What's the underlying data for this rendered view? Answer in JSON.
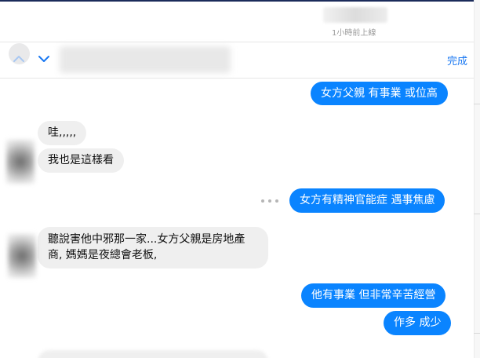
{
  "header": {
    "status": "1小時前上線"
  },
  "search": {
    "done_label": "完成"
  },
  "messages": [
    {
      "direction": "outgoing",
      "text": "女方父親 有事業 或位高"
    },
    {
      "direction": "incoming",
      "text": "哇,,,,,"
    },
    {
      "direction": "incoming",
      "text": "我也是這樣看"
    },
    {
      "direction": "outgoing",
      "text": "女方有精神官能症 遇事焦慮"
    },
    {
      "direction": "incoming",
      "lines": [
        "聽說害他中邪那一家...女方父親是房地產",
        "商, 媽媽是夜總會老板,"
      ]
    },
    {
      "direction": "outgoing",
      "text": "他有事業 但非常辛苦經營"
    },
    {
      "direction": "outgoing",
      "text": "作多 成少"
    }
  ],
  "colors": {
    "outgoing_bubble": "#0a84ff",
    "incoming_bubble": "#efefef",
    "accent": "#1877f2"
  },
  "icons": [
    "chevron-up-icon",
    "chevron-down-icon",
    "more-options-icon"
  ]
}
